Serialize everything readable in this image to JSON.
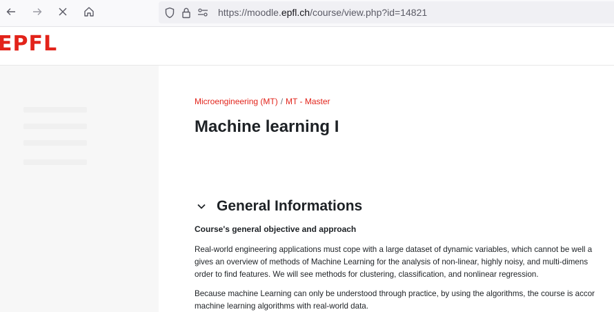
{
  "browser": {
    "url_prefix": "https://moodle.",
    "url_domain": "epfl.ch",
    "url_path": "/course/view.php?id=14821",
    "icons": [
      "back-arrow-icon",
      "forward-arrow-icon",
      "close-icon",
      "home-icon",
      "shield-icon",
      "lock-icon",
      "permissions-icon"
    ]
  },
  "header": {
    "logo": "EPFL"
  },
  "breadcrumb": {
    "items": [
      "Microengineering (MT)",
      "MT - Master"
    ],
    "separator": "/"
  },
  "course": {
    "title": "Machine learning I"
  },
  "section": {
    "title": "General Informations",
    "subheading": "Course's general objective and approach",
    "paragraph1": [
      "Real-world engineering applications must cope with a large dataset of dynamic variables, which cannot be well a",
      "gives an overview of methods of Machine Learning for the analysis of non-linear, highly noisy, and multi-dimens",
      "order to find features. We will see methods for clustering, classification, and nonlinear regression."
    ],
    "paragraph2": [
      "Because machine Learning can only be understood through practice, by using the algorithms, the course is accor",
      "machine learning algorithms with real-world data."
    ]
  },
  "colors": {
    "brand_red": "#e2231a",
    "text": "#1d2125",
    "drawer_bg": "#f7f7f7",
    "toolbar_bg": "#f9f9fb"
  }
}
